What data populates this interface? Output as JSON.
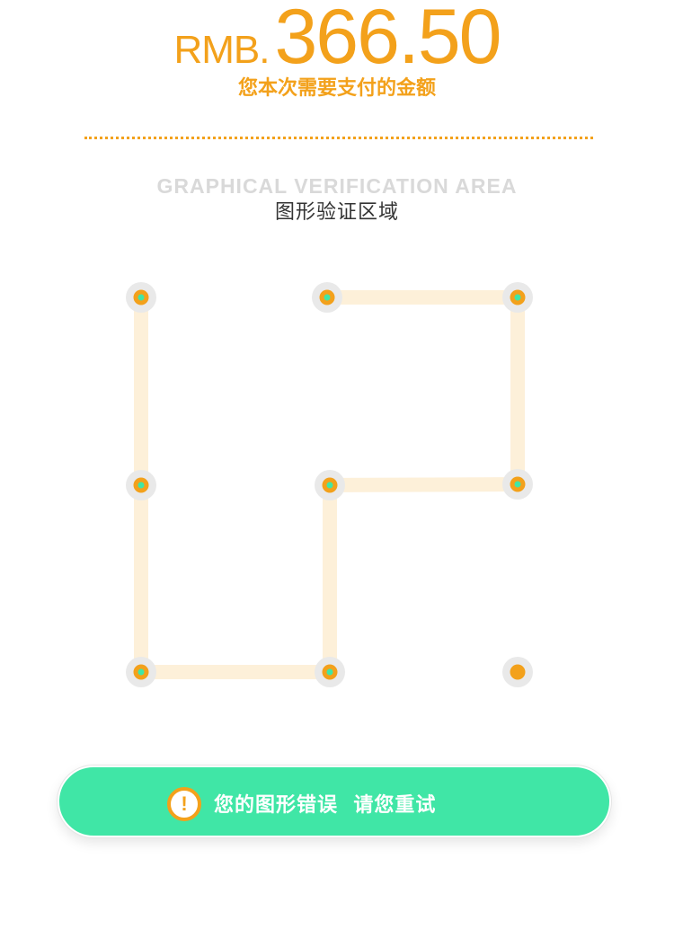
{
  "payment": {
    "currency": "RMB.",
    "amount": "366.50",
    "caption": "您本次需要支付的金额"
  },
  "verification_area": {
    "title_en": "GRAPHICAL VERIFICATION AREA",
    "title_cn": "图形验证区域"
  },
  "pattern": {
    "grid": "3x3",
    "selected_sequence": [
      1,
      4,
      7,
      8,
      5,
      6,
      3,
      2
    ],
    "unselected_nodes": [
      9
    ]
  },
  "error_banner": {
    "icon": "warning-icon",
    "icon_glyph": "!",
    "message": "您的图形错误  请您重试"
  },
  "colors": {
    "accent_orange": "#f3a11b",
    "success_green": "#40e6a6",
    "node_center_green": "#40e6a6",
    "path_fill": "#fdf0d9",
    "node_halo": "#e9e9e9"
  }
}
